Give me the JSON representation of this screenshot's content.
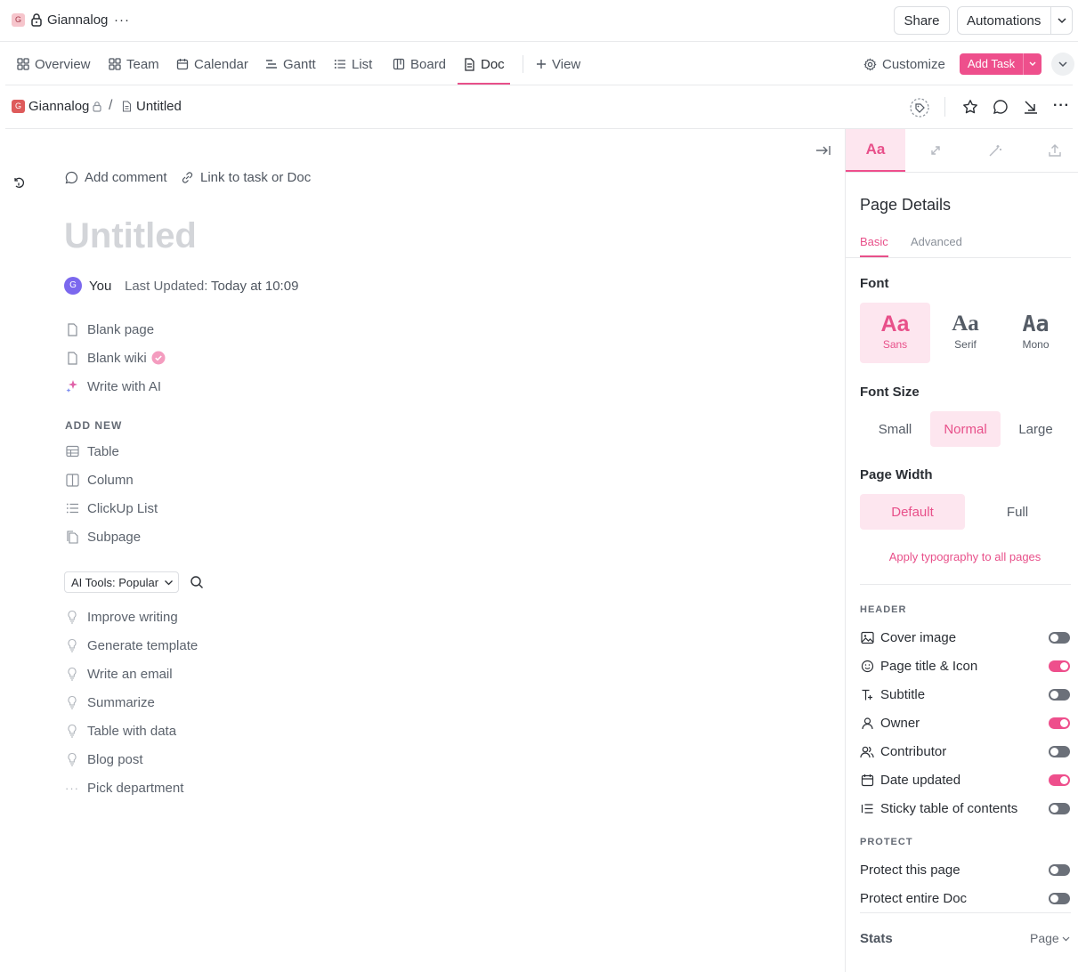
{
  "workspace": {
    "badge": "G",
    "name": "Giannalog"
  },
  "topbar": {
    "share_label": "Share",
    "automations_label": "Automations"
  },
  "tabs": [
    {
      "label": "Overview"
    },
    {
      "label": "Team"
    },
    {
      "label": "Calendar"
    },
    {
      "label": "Gantt"
    },
    {
      "label": "List"
    },
    {
      "label": "Board"
    },
    {
      "label": "Doc"
    }
  ],
  "tabbar": {
    "add_view_label": "View",
    "customize_label": "Customize",
    "add_task_label": "Add Task"
  },
  "breadcrumb": {
    "workspace_badge": "G",
    "workspace": "Giannalog",
    "separator": "/",
    "doc": "Untitled"
  },
  "doc": {
    "add_comment_label": "Add comment",
    "link_label": "Link to task or Doc",
    "title_placeholder": "Untitled",
    "author_avatar": "G",
    "author": "You",
    "last_updated_label": "Last Updated:",
    "last_updated_value": "Today at 10:09",
    "templates": [
      {
        "label": "Blank page",
        "icon": "page-icon"
      },
      {
        "label": "Blank wiki",
        "icon": "page-icon"
      },
      {
        "label": "Write with AI",
        "icon": "sparkle-icon"
      }
    ],
    "add_new_heading": "ADD NEW",
    "add_new": [
      {
        "label": "Table",
        "icon": "table-icon"
      },
      {
        "label": "Column",
        "icon": "column-icon"
      },
      {
        "label": "ClickUp List",
        "icon": "list-icon"
      },
      {
        "label": "Subpage",
        "icon": "subpage-icon"
      }
    ],
    "ai_tools_select": "AI Tools: Popular",
    "ai_tools": [
      {
        "label": "Improve writing"
      },
      {
        "label": "Generate template"
      },
      {
        "label": "Write an email"
      },
      {
        "label": "Summarize"
      },
      {
        "label": "Table with data"
      },
      {
        "label": "Blog post"
      },
      {
        "label": "Pick department"
      }
    ]
  },
  "panel": {
    "font_tab_label": "Aa",
    "title": "Page Details",
    "subtabs": {
      "basic": "Basic",
      "advanced": "Advanced"
    },
    "font_heading": "Font",
    "fonts": [
      {
        "sample": "Aa",
        "name": "Sans"
      },
      {
        "sample": "Aa",
        "name": "Serif"
      },
      {
        "sample": "Aa",
        "name": "Mono"
      }
    ],
    "font_size_heading": "Font Size",
    "font_sizes": {
      "small": "Small",
      "normal": "Normal",
      "large": "Large"
    },
    "page_width_heading": "Page Width",
    "page_widths": {
      "default": "Default",
      "full": "Full"
    },
    "apply_all_label": "Apply typography to all pages",
    "header_heading": "HEADER",
    "header_rows": [
      {
        "label": "Cover image",
        "on": false
      },
      {
        "label": "Page title & Icon",
        "on": true
      },
      {
        "label": "Subtitle",
        "on": false
      },
      {
        "label": "Owner",
        "on": true
      },
      {
        "label": "Contributor",
        "on": false
      },
      {
        "label": "Date updated",
        "on": true
      },
      {
        "label": "Sticky table of contents",
        "on": false
      }
    ],
    "protect_heading": "PROTECT",
    "protect_rows": [
      {
        "label": "Protect this page",
        "on": false
      },
      {
        "label": "Protect entire Doc",
        "on": false
      }
    ],
    "stats_label": "Stats",
    "stats_scope": "Page",
    "accent_color": "#ee4f8c"
  }
}
